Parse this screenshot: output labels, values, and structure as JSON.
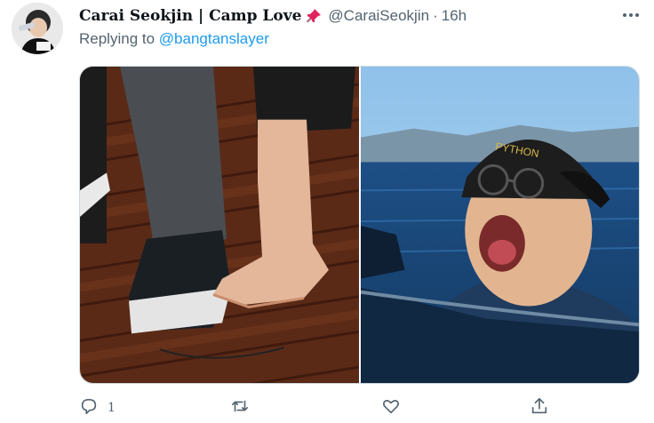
{
  "tweet": {
    "display_name": "Carai Seokjin | Camp Love",
    "handle": "@CaraiSeokjin",
    "separator": "·",
    "time": "16h",
    "replying_prefix": "Replying to",
    "replying_handle": "@bangtanslayer",
    "media": {
      "left_image": "photo-feet-on-deck",
      "right_image": "photo-man-in-sea-cap",
      "cap_text": "PYTHON"
    },
    "actions": {
      "reply_count": "1",
      "retweet_count": "",
      "like_count": ""
    }
  },
  "icons": {
    "pin": "pushpin-icon",
    "more": "more-icon",
    "reply": "reply-icon",
    "retweet": "retweet-icon",
    "like": "heart-icon",
    "share": "share-icon"
  },
  "colors": {
    "link": "#1d9bf0",
    "secondary_text": "#536471",
    "primary_text": "#0f1419",
    "pin": "#e0245e"
  }
}
